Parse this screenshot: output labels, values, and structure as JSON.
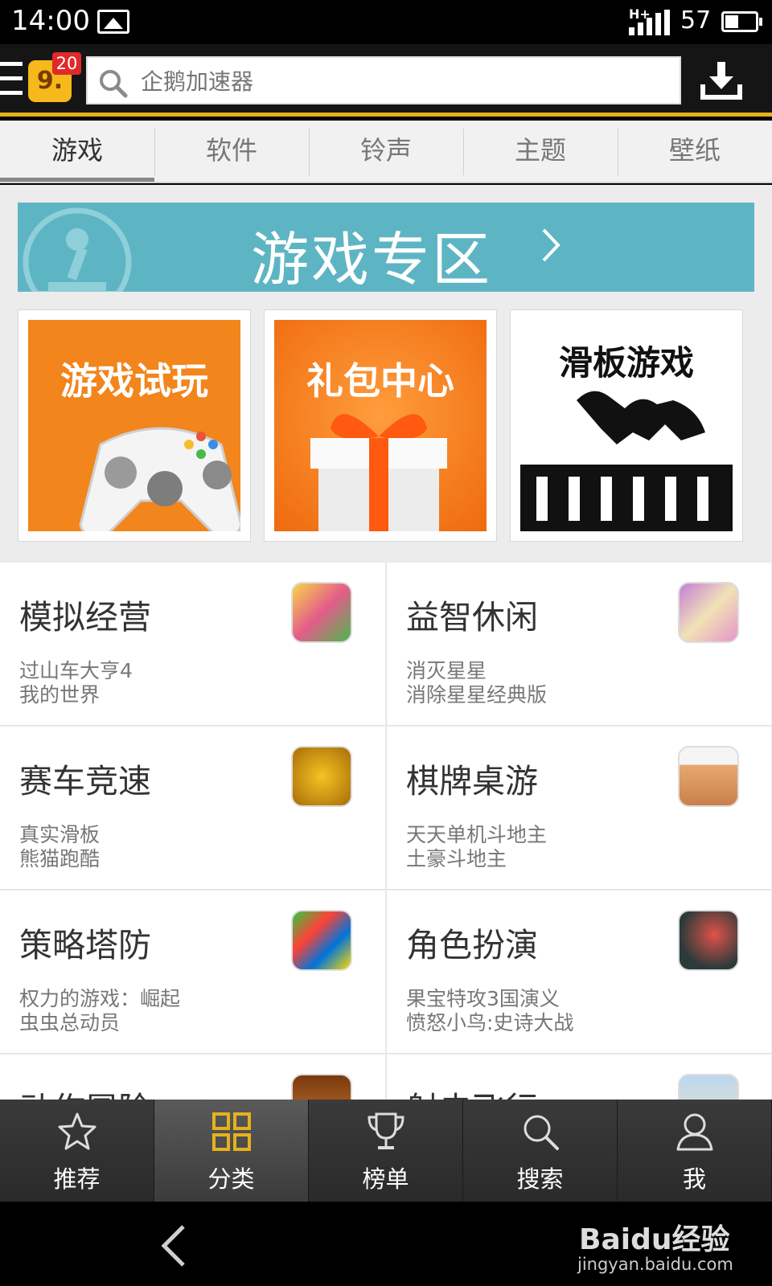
{
  "status_bar": {
    "time": "14:00",
    "network": "H+",
    "battery": "57"
  },
  "top_bar": {
    "notification_count": "20",
    "logo_text": "9.",
    "search_placeholder": "企鹅加速器"
  },
  "tabs": [
    {
      "label": "游戏",
      "active": true
    },
    {
      "label": "软件",
      "active": false
    },
    {
      "label": "铃声",
      "active": false
    },
    {
      "label": "主题",
      "active": false
    },
    {
      "label": "壁纸",
      "active": false
    }
  ],
  "banner": {
    "title": "游戏专区"
  },
  "tiles": [
    {
      "label": "游戏试玩"
    },
    {
      "label": "礼包中心"
    },
    {
      "label": "滑板游戏"
    }
  ],
  "categories": [
    {
      "title": "模拟经营",
      "items": [
        "过山车大亨4",
        "我的世界"
      ]
    },
    {
      "title": "益智休闲",
      "items": [
        "消灭星星",
        "消除星星经典版"
      ]
    },
    {
      "title": "赛车竞速",
      "items": [
        "真实滑板",
        "熊猫跑酷"
      ]
    },
    {
      "title": "棋牌桌游",
      "items": [
        "天天单机斗地主",
        "土豪斗地主"
      ]
    },
    {
      "title": "策略塔防",
      "items": [
        "权力的游戏：崛起",
        "虫虫总动员"
      ]
    },
    {
      "title": "角色扮演",
      "items": [
        "果宝特攻3国演义",
        "愤怒小鸟:史诗大战"
      ]
    },
    {
      "title": "动作冒险",
      "items": [
        "",
        ""
      ]
    },
    {
      "title": "射击飞行",
      "items": [
        "",
        ""
      ]
    }
  ],
  "bottom_nav": [
    {
      "label": "推荐",
      "icon": "star-icon",
      "active": false
    },
    {
      "label": "分类",
      "icon": "grid-icon",
      "active": true
    },
    {
      "label": "榜单",
      "icon": "trophy-icon",
      "active": false
    },
    {
      "label": "搜索",
      "icon": "search-icon",
      "active": false
    },
    {
      "label": "我",
      "icon": "user-icon",
      "active": false
    }
  ],
  "watermark": {
    "brand": "Baidu经验",
    "url": "jingyan.baidu.com"
  },
  "colors": {
    "accent": "#e5b21c",
    "banner": "#5db5c4",
    "tile_orange": "#f2851c"
  }
}
